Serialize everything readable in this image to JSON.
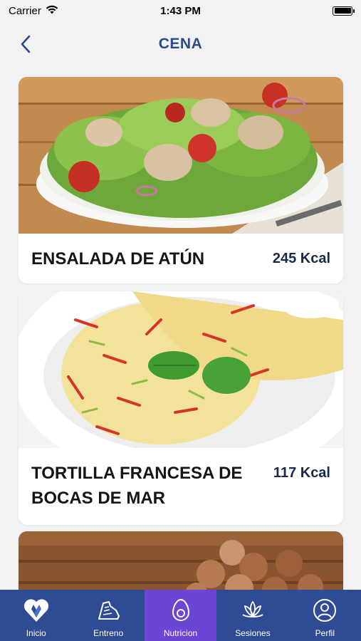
{
  "status_bar": {
    "carrier": "Carrier",
    "time": "1:43 PM"
  },
  "header": {
    "title": "CENA",
    "back_icon": "chevron-left-icon"
  },
  "recipes": [
    {
      "name": "ENSALADA DE ATÚN",
      "kcal": "245 Kcal",
      "image": "tuna-salad-photo"
    },
    {
      "name": "TORTILLA FRANCESA DE BOCAS DE MAR",
      "kcal": "117 Kcal",
      "image": "omelette-photo"
    },
    {
      "name": "",
      "kcal": "",
      "image": "hazelnuts-photo"
    }
  ],
  "tabs": [
    {
      "label": "Inicio",
      "icon": "heart-ribbon-icon",
      "active": false
    },
    {
      "label": "Entreno",
      "icon": "sneaker-icon",
      "active": false
    },
    {
      "label": "Nutricion",
      "icon": "avocado-icon",
      "active": true
    },
    {
      "label": "Sesiones",
      "icon": "lotus-icon",
      "active": false
    },
    {
      "label": "Perfil",
      "icon": "user-circle-icon",
      "active": false
    }
  ],
  "colors": {
    "accent": "#2c4a86",
    "tab_bar": "#2e4b93",
    "tab_active": "#6a46d2",
    "background": "#f2f2f4"
  }
}
